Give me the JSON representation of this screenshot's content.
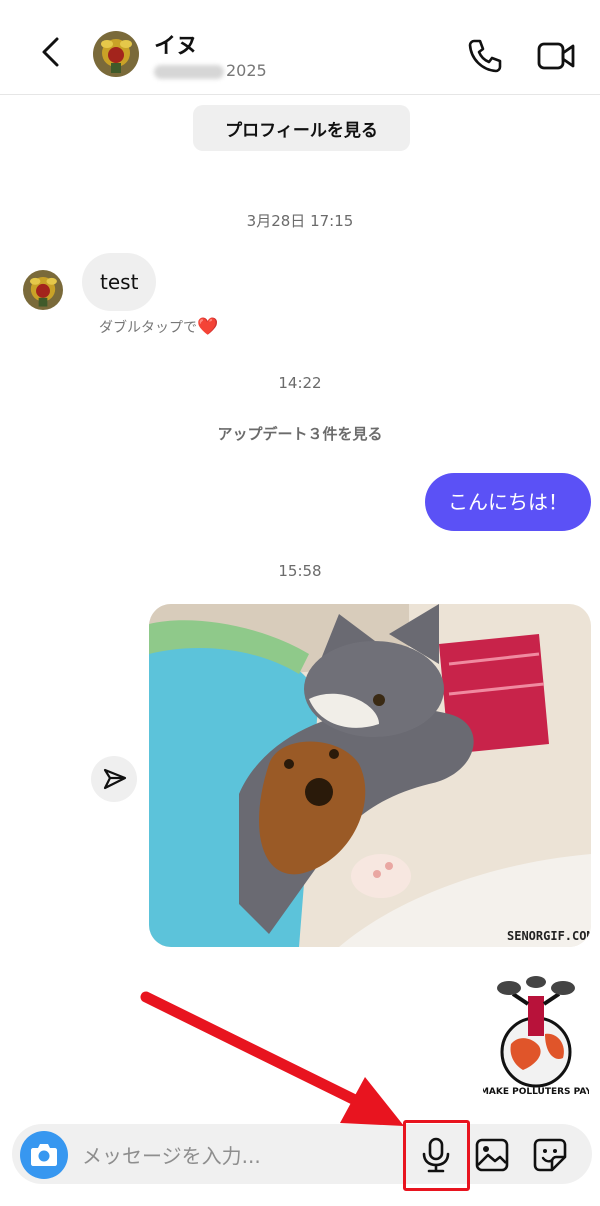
{
  "header": {
    "name": "イヌ",
    "username_suffix": "2025",
    "back_icon": "chevron-left-icon",
    "call_icon": "phone-icon",
    "video_icon": "video-camera-icon"
  },
  "profile_button_label": "プロフィールを見る",
  "thread": {
    "timestamp_1": "3月28日 17:15",
    "incoming_text": "test",
    "reaction_hint": "ダブルタップで",
    "reaction_heart": "❤️",
    "timestamp_2": "14:22",
    "updates_link": "アップデート３件を見る",
    "outgoing_text": "こんにちは！",
    "timestamp_3": "15:58",
    "media_watermark": "SENORGIF.COM",
    "sticker_text": "MAKE POLLUTERS PAY"
  },
  "composer": {
    "placeholder": "メッセージを入力...",
    "camera_icon": "camera-icon",
    "mic_icon": "microphone-icon",
    "gallery_icon": "image-icon",
    "sticker_icon": "sticker-icon"
  },
  "colors": {
    "accent_blue": "#3797f0",
    "outgoing_bubble": "#5b51f6",
    "annotation_red": "#e8141f"
  }
}
